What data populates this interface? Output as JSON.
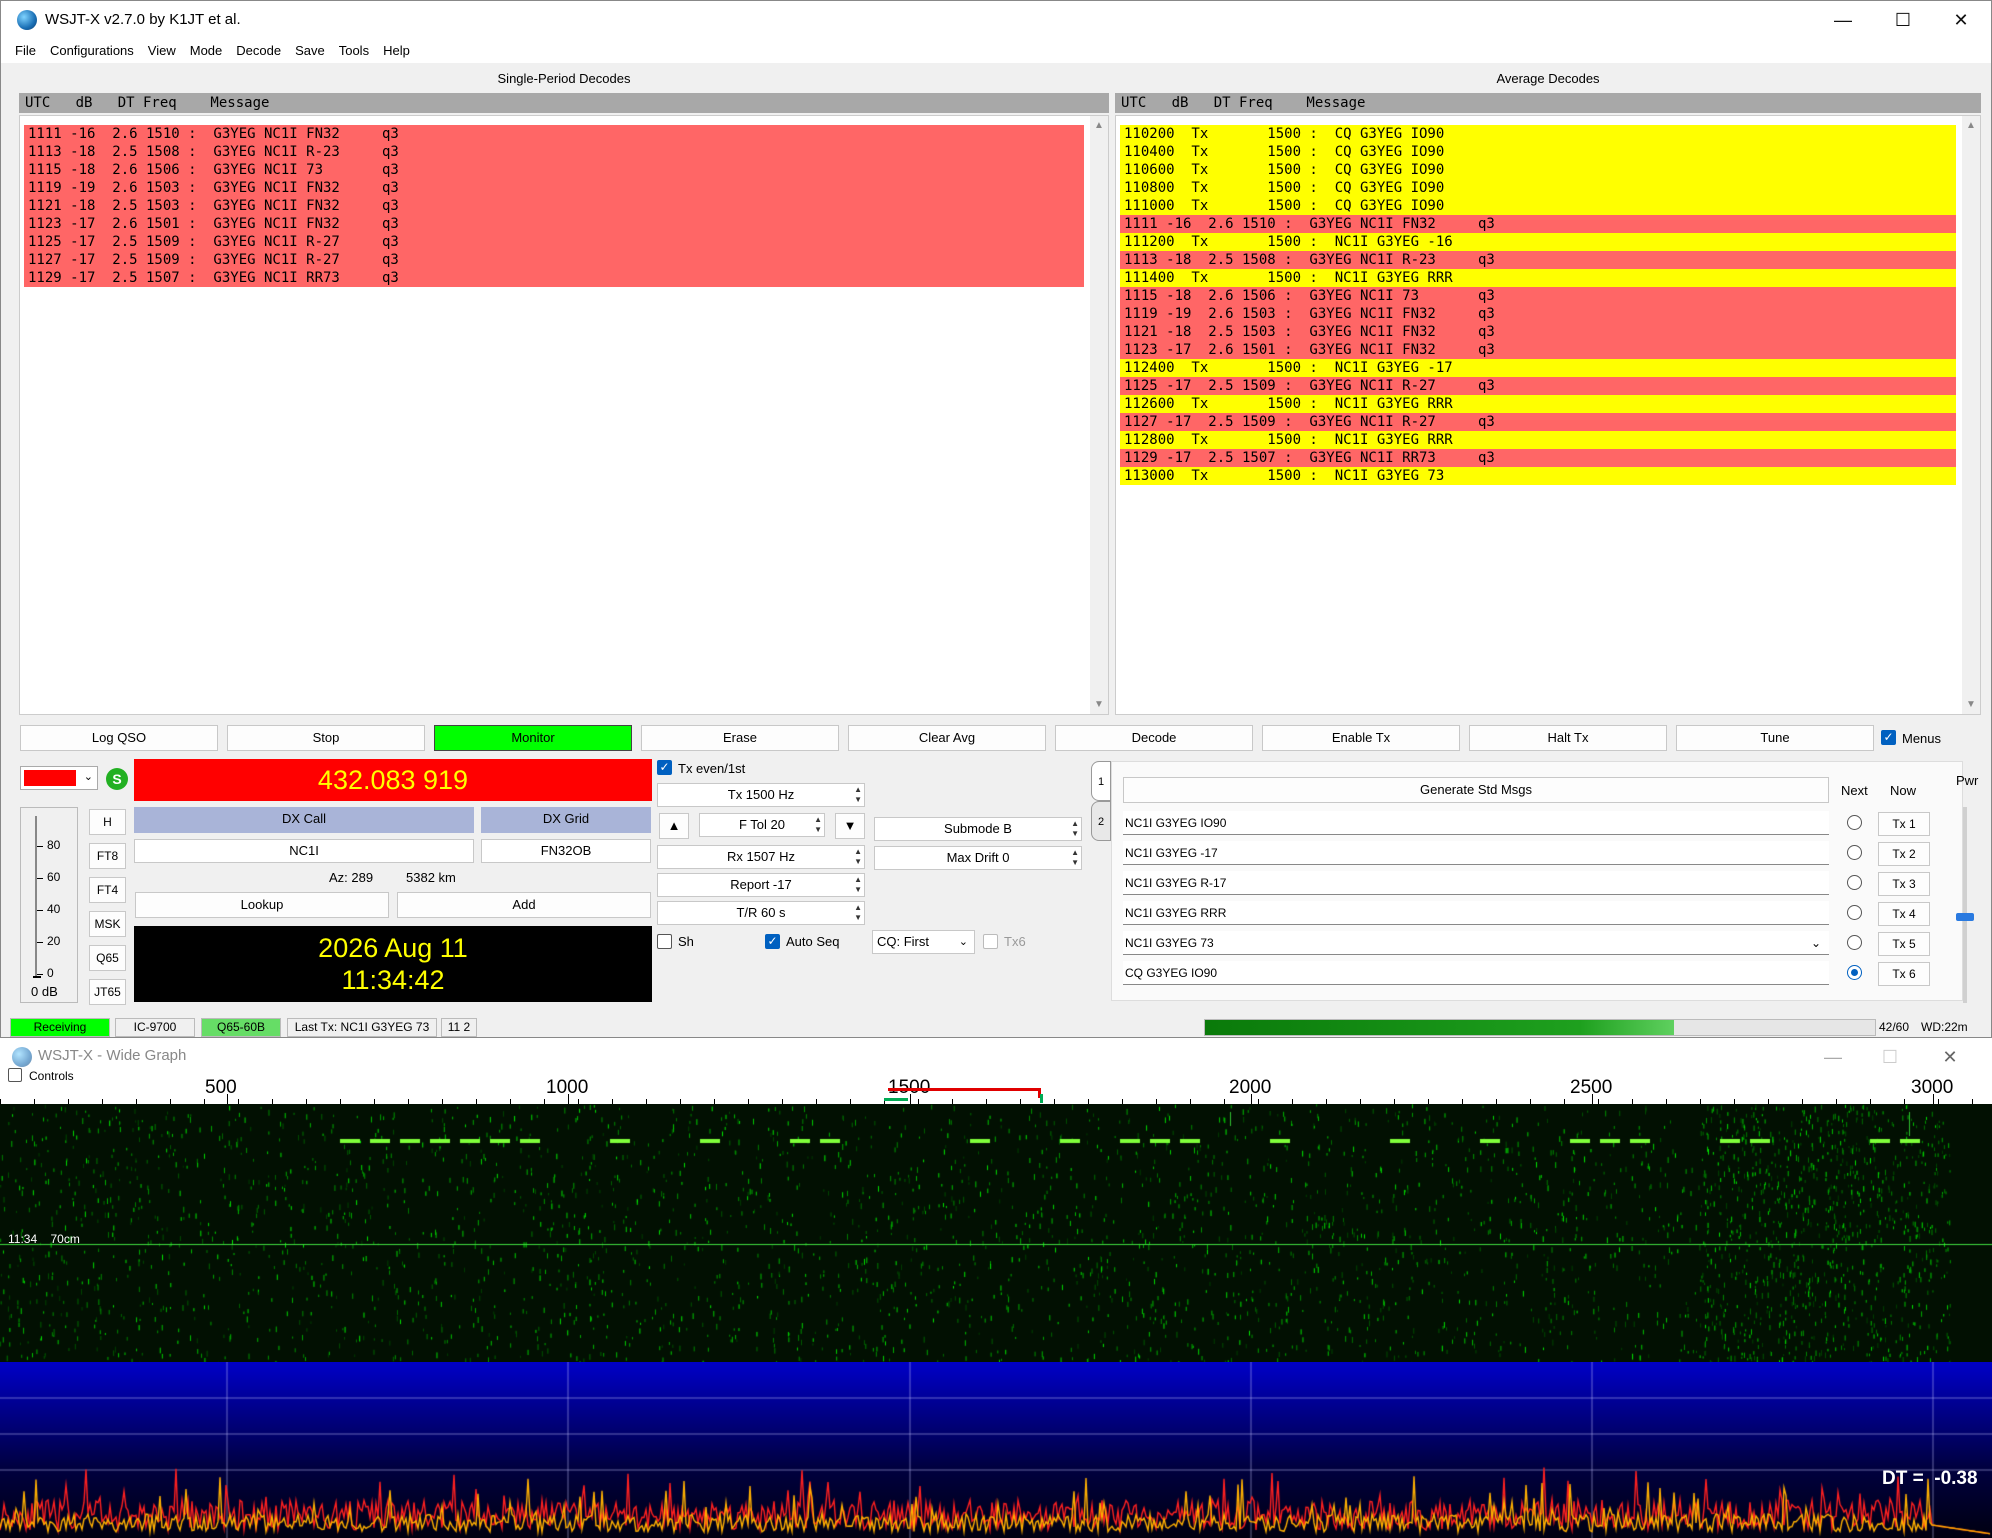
{
  "app": {
    "title": "WSJT-X   v2.7.0   by K1JT et al.",
    "menu": [
      "File",
      "Configurations",
      "View",
      "Mode",
      "Decode",
      "Save",
      "Tools",
      "Help"
    ]
  },
  "single_period": {
    "title": "Single-Period Decodes",
    "header": "UTC   dB   DT Freq    Message",
    "rows": [
      "1111 -16  2.6 1510 :  G3YEG NC1I FN32     q3",
      "1113 -18  2.5 1508 :  G3YEG NC1I R-23     q3",
      "1115 -18  2.6 1506 :  G3YEG NC1I 73       q3",
      "1119 -19  2.6 1503 :  G3YEG NC1I FN32     q3",
      "1121 -18  2.5 1503 :  G3YEG NC1I FN32     q3",
      "1123 -17  2.6 1501 :  G3YEG NC1I FN32     q3",
      "1125 -17  2.5 1509 :  G3YEG NC1I R-27     q3",
      "1127 -17  2.5 1509 :  G3YEG NC1I R-27     q3",
      "1129 -17  2.5 1507 :  G3YEG NC1I RR73     q3"
    ]
  },
  "average": {
    "title": "Average Decodes",
    "header": "UTC   dB   DT Freq    Message",
    "rows": [
      {
        "text": "110200  Tx       1500 :  CQ G3YEG IO90",
        "color": "yellow"
      },
      {
        "text": "110400  Tx       1500 :  CQ G3YEG IO90",
        "color": "yellow"
      },
      {
        "text": "110600  Tx       1500 :  CQ G3YEG IO90",
        "color": "yellow"
      },
      {
        "text": "110800  Tx       1500 :  CQ G3YEG IO90",
        "color": "yellow"
      },
      {
        "text": "111000  Tx       1500 :  CQ G3YEG IO90",
        "color": "yellow"
      },
      {
        "text": "1111 -16  2.6 1510 :  G3YEG NC1I FN32     q3",
        "color": "red"
      },
      {
        "text": "111200  Tx       1500 :  NC1I G3YEG -16",
        "color": "yellow"
      },
      {
        "text": "1113 -18  2.5 1508 :  G3YEG NC1I R-23     q3",
        "color": "red"
      },
      {
        "text": "111400  Tx       1500 :  NC1I G3YEG RRR",
        "color": "yellow"
      },
      {
        "text": "1115 -18  2.6 1506 :  G3YEG NC1I 73       q3",
        "color": "red"
      },
      {
        "text": "1119 -19  2.6 1503 :  G3YEG NC1I FN32     q3",
        "color": "red"
      },
      {
        "text": "1121 -18  2.5 1503 :  G3YEG NC1I FN32     q3",
        "color": "red"
      },
      {
        "text": "1123 -17  2.6 1501 :  G3YEG NC1I FN32     q3",
        "color": "red"
      },
      {
        "text": "112400  Tx       1500 :  NC1I G3YEG -17",
        "color": "yellow"
      },
      {
        "text": "1125 -17  2.5 1509 :  G3YEG NC1I R-27     q3",
        "color": "red"
      },
      {
        "text": "112600  Tx       1500 :  NC1I G3YEG RRR",
        "color": "yellow"
      },
      {
        "text": "1127 -17  2.5 1509 :  G3YEG NC1I R-27     q3",
        "color": "red"
      },
      {
        "text": "112800  Tx       1500 :  NC1I G3YEG RRR",
        "color": "yellow"
      },
      {
        "text": "1129 -17  2.5 1507 :  G3YEG NC1I RR73     q3",
        "color": "red"
      },
      {
        "text": "113000  Tx       1500 :  NC1I G3YEG 73",
        "color": "yellow"
      }
    ]
  },
  "buttons": {
    "log_qso": "Log QSO",
    "stop": "Stop",
    "monitor": "Monitor",
    "erase": "Erase",
    "clear_avg": "Clear Avg",
    "decode": "Decode",
    "enable_tx": "Enable Tx",
    "halt_tx": "Halt Tx",
    "tune": "Tune",
    "menus": "Menus"
  },
  "radio": {
    "frequency": "432.083 919",
    "s_badge": "S",
    "dx_call_label": "DX Call",
    "dx_grid_label": "DX Grid",
    "dx_call": "NC1I",
    "dx_grid": "FN32OB",
    "az": "Az: 289",
    "distance": "5382 km",
    "lookup": "Lookup",
    "add": "Add",
    "date": "2026 Aug 11",
    "time": "11:34:42",
    "level": "0 dB",
    "meter_ticks": [
      "80",
      "60",
      "40",
      "20",
      "0"
    ],
    "mode_buttons": [
      "H",
      "FT8",
      "FT4",
      "MSK",
      "Q65",
      "JT65"
    ]
  },
  "controls": {
    "tx_even": "Tx even/1st",
    "tx": "Tx  1500  Hz",
    "ftol": "F Tol  20",
    "rx": "Rx  1507  Hz",
    "report": "Report -17",
    "tr": "T/R  60  s",
    "submode": "Submode B",
    "max_drift": "Max Drift  0",
    "sh": "Sh",
    "auto_seq": "Auto Seq",
    "cq": "CQ: First",
    "tx6_chk": "Tx6",
    "up": "▲",
    "down": "▼"
  },
  "messages": {
    "tab1": "1",
    "tab2": "2",
    "generate": "Generate Std Msgs",
    "next_label": "Next",
    "now_label": "Now",
    "pwr_label": "Pwr",
    "list": [
      {
        "msg": "NC1I G3YEG IO90",
        "btn": "Tx 1"
      },
      {
        "msg": "NC1I G3YEG -17",
        "btn": "Tx 2"
      },
      {
        "msg": "NC1I G3YEG R-17",
        "btn": "Tx 3"
      },
      {
        "msg": "NC1I G3YEG RRR",
        "btn": "Tx 4"
      },
      {
        "msg": "NC1I G3YEG 73",
        "btn": "Tx 5"
      },
      {
        "msg": "CQ G3YEG IO90",
        "btn": "Tx 6"
      }
    ],
    "selected_next": 6
  },
  "status": {
    "receiving": "Receiving",
    "rig": "IC-9700",
    "mode": "Q65-60B",
    "last_tx": "Last Tx: NC1I G3YEG 73",
    "seq": "11  2",
    "progress_fraction": 0.7,
    "progress_text": "42/60",
    "wd": "WD:22m"
  },
  "wide_graph": {
    "title": "WSJT-X - Wide Graph",
    "controls": "Controls",
    "ticks": [
      "500",
      "1000",
      "1500",
      "2000",
      "2500",
      "3000"
    ],
    "time_label": "11:34    70cm",
    "dt": "DT =  -0.38"
  },
  "colors": {
    "decode_red": "#ff6666",
    "decode_yellow": "#ffff00",
    "monitor_green": "#00ff00",
    "freq_red": "#ff0000",
    "dx_label_blue": "#a9b4d8",
    "clock_bg": "#000000",
    "clock_fg": "#ffff00"
  }
}
